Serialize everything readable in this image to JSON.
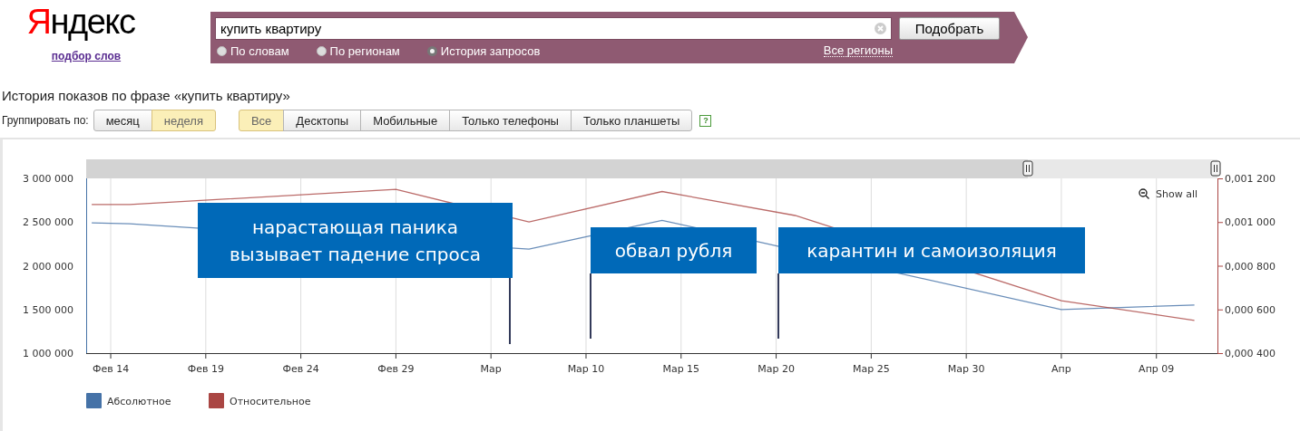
{
  "logo": {
    "text": "Яндекс",
    "link": "подбор слов"
  },
  "search": {
    "value": "купить квартиру",
    "button": "Подобрать",
    "region_link": "Все регионы",
    "modes": [
      {
        "label": "По словам",
        "selected": false
      },
      {
        "label": "По регионам",
        "selected": false
      },
      {
        "label": "История запросов",
        "selected": true
      }
    ]
  },
  "page_title": "История показов по фразе «купить квартиру»",
  "grouping": {
    "label": "Группировать по:",
    "options": [
      {
        "label": "месяц",
        "selected": false
      },
      {
        "label": "неделя",
        "selected": true
      }
    ]
  },
  "devices": [
    {
      "label": "Все",
      "selected": true
    },
    {
      "label": "Десктопы",
      "selected": false
    },
    {
      "label": "Мобильные",
      "selected": false
    },
    {
      "label": "Только телефоны",
      "selected": false
    },
    {
      "label": "Только планшеты",
      "selected": false
    }
  ],
  "help": "?",
  "chart": {
    "show_all": "Show all",
    "chart_data": {
      "type": "line",
      "categories": [
        null,
        "Фев 14",
        null,
        null,
        null,
        null,
        "Фев 19",
        null,
        null,
        null,
        null,
        "Фев 24",
        null,
        null,
        null,
        null,
        "Фев 29",
        null,
        null,
        null,
        null,
        "Мар",
        null,
        null,
        null,
        null,
        "Мар 10",
        null,
        null,
        null,
        null,
        "Мар 15",
        null,
        null,
        null,
        null,
        "Мар 20",
        null,
        null,
        null,
        null,
        "Мар 25",
        null,
        null,
        null,
        null,
        "Мар 30",
        null,
        null,
        null,
        null,
        "Апр",
        null,
        null,
        null,
        null,
        "Апр 09",
        null,
        null,
        null
      ],
      "ylim": [
        1000000,
        3000000
      ],
      "y2lim": [
        0.0004,
        0.0012
      ],
      "grid": true,
      "legend": "bottom",
      "yticks": [
        {
          "value": 1000000,
          "label": "1 000 000"
        },
        {
          "value": 1500000,
          "label": "1 500 000"
        },
        {
          "value": 2000000,
          "label": "2 000 000"
        },
        {
          "value": 2500000,
          "label": "2 500 000"
        },
        {
          "value": 3000000,
          "label": "3 000 000"
        }
      ],
      "y2ticks": [
        {
          "value": 0.0004,
          "label": "0,000 400"
        },
        {
          "value": 0.0006,
          "label": "0,000 600"
        },
        {
          "value": 0.0008,
          "label": "0,000 800"
        },
        {
          "value": 0.001,
          "label": "0,001 000"
        },
        {
          "value": 0.0012,
          "label": "0,001 200"
        }
      ],
      "series": [
        {
          "name": "Абсолютное",
          "color": "#4572a7",
          "values": [
            2490000,
            null,
            2480000,
            null,
            null,
            null,
            null,
            null,
            null,
            null,
            null,
            null,
            null,
            null,
            null,
            null,
            null,
            null,
            null,
            null,
            null,
            null,
            null,
            2190000,
            null,
            null,
            null,
            null,
            null,
            null,
            2520000,
            null,
            null,
            null,
            null,
            null,
            null,
            null,
            null,
            null,
            null,
            null,
            null,
            null,
            null,
            null,
            null,
            null,
            null,
            null,
            null,
            1500000,
            null,
            null,
            null,
            null,
            null,
            null,
            1550000,
            null
          ]
        },
        {
          "name": "Относительное",
          "color": "#aa4643",
          "axis": "y2",
          "values": [
            0.00108,
            null,
            0.00108,
            null,
            null,
            null,
            null,
            null,
            null,
            null,
            null,
            null,
            null,
            null,
            null,
            null,
            0.00115,
            null,
            null,
            null,
            null,
            null,
            null,
            0.001,
            null,
            null,
            null,
            null,
            null,
            null,
            0.00114,
            null,
            null,
            null,
            null,
            null,
            null,
            0.00103,
            null,
            null,
            null,
            null,
            null,
            null,
            null,
            null,
            null,
            null,
            null,
            null,
            null,
            0.00064,
            null,
            null,
            null,
            null,
            null,
            null,
            0.00055,
            null
          ]
        }
      ],
      "annotations": [
        "нарастающая паника вызывает падение спроса",
        "обвал рубля",
        "карантин и самоизоляция"
      ]
    }
  }
}
